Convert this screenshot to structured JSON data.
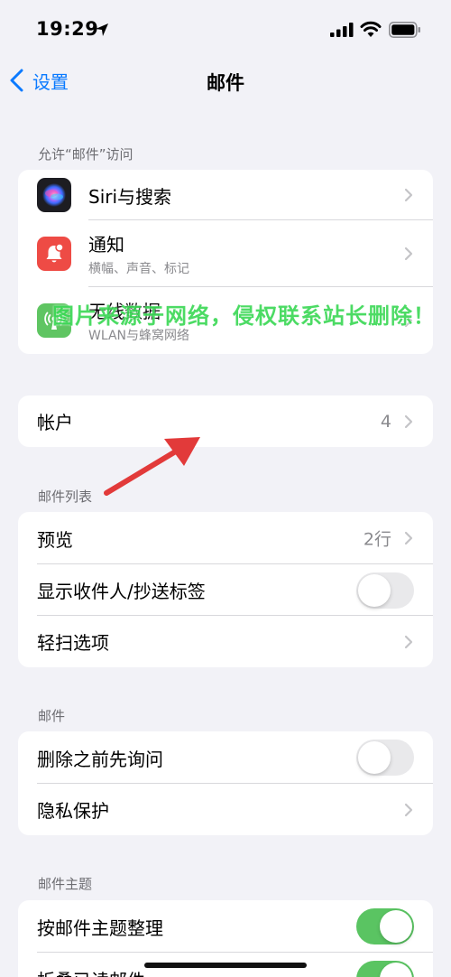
{
  "status_bar": {
    "time": "19:29"
  },
  "nav": {
    "back_label": "设置",
    "title": "邮件"
  },
  "allow_access": {
    "header": "允许“邮件”访问",
    "items": [
      {
        "label": "Siri与搜索",
        "icon": "siri-icon"
      },
      {
        "label": "通知",
        "subtitle": "横幅、声音、标记",
        "icon": "bell-icon"
      },
      {
        "label": "无线数据",
        "subtitle": "WLAN与蜂窝网络",
        "icon": "antenna-icon"
      }
    ]
  },
  "accounts": {
    "label": "帐户",
    "value": "4"
  },
  "message_list": {
    "header": "邮件列表",
    "preview_label": "预览",
    "preview_value": "2行",
    "show_to_cc_label": "显示收件人/抄送标签",
    "show_to_cc": false,
    "swipe_label": "轻扫选项"
  },
  "messages": {
    "header": "邮件",
    "ask_before_delete_label": "删除之前先询问",
    "ask_before_delete": false,
    "privacy_label": "隐私保护"
  },
  "threading": {
    "header": "邮件主题",
    "organize_label": "按邮件主题整理",
    "organize": true,
    "collapse_label": "折叠已读邮件",
    "collapse": true
  },
  "watermark": "图片来源于网络，侵权联系站长删除！",
  "colors": {
    "accent": "#0a7aff",
    "toggle_on": "#5ac462",
    "watermark": "#3dd857",
    "arrow": "#e23a3a"
  }
}
